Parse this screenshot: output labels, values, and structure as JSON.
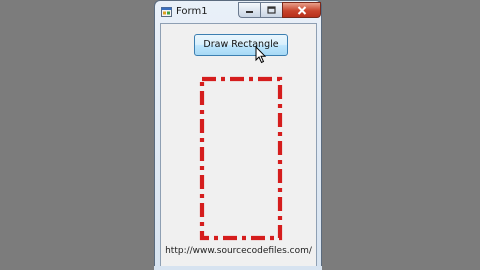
{
  "window": {
    "title": "Form1",
    "icon": "form-app-icon",
    "caption_buttons": [
      "minimize-icon",
      "maximize-icon",
      "close-icon"
    ]
  },
  "form": {
    "button_label": "Draw Rectangle",
    "footer_text": "http://www.sourcecodefiles.com/",
    "rectangle": {
      "stroke_color": "#d51d1d",
      "dash_style": "dash-dot"
    }
  },
  "colors": {
    "desktop": "#7c7c7c",
    "form_background": "#f0f0f0",
    "close_button": "#c8452d"
  }
}
